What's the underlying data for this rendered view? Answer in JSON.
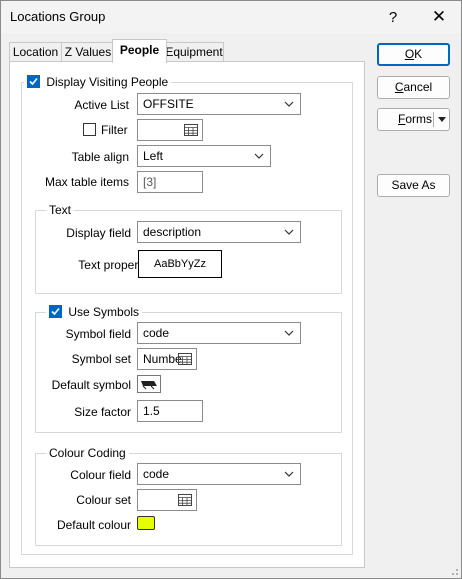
{
  "window": {
    "title": "Locations Group",
    "help_glyph": "?",
    "close_glyph": "✕"
  },
  "tabs": [
    {
      "label": "Location"
    },
    {
      "label": "Z Values"
    },
    {
      "label": "People",
      "active": true
    },
    {
      "label": "Equipment"
    }
  ],
  "display_visiting": {
    "label": "Display Visiting People",
    "checked": true
  },
  "active_list": {
    "label": "Active List",
    "value": "OFFSITE"
  },
  "filter": {
    "label": "Filter",
    "checked": false,
    "value": ""
  },
  "table_align": {
    "label": "Table align",
    "value": "Left"
  },
  "max_table_items": {
    "label": "Max table items",
    "value": "[3]"
  },
  "text_group": {
    "legend": "Text",
    "display_field_label": "Display field",
    "display_field_value": "description",
    "text_properties_label": "Text properties",
    "text_properties_sample": "AaBbYyZz"
  },
  "symbols_group": {
    "legend": "Use Symbols",
    "checked": true,
    "symbol_field_label": "Symbol field",
    "symbol_field_value": "code",
    "symbol_set_label": "Symbol set",
    "symbol_set_value": "Numbe",
    "default_symbol_label": "Default symbol",
    "size_factor_label": "Size factor",
    "size_factor_value": "1.5"
  },
  "colour_group": {
    "legend": "Colour Coding",
    "colour_field_label": "Colour field",
    "colour_field_value": "code",
    "colour_set_label": "Colour set",
    "colour_set_value": "",
    "default_colour_label": "Default colour",
    "default_colour": "#e6ff00"
  },
  "buttons": {
    "ok": {
      "prefix": "",
      "mnemonic": "O",
      "suffix": "K"
    },
    "cancel": {
      "prefix": "",
      "mnemonic": "C",
      "suffix": "ancel"
    },
    "forms": {
      "prefix": "",
      "mnemonic": "F",
      "suffix": "orms"
    },
    "save_as": "Save As"
  },
  "colors": {
    "accent": "#0067c0",
    "tab_border": "#c8c8c8",
    "group_border": "#d8d8d8"
  }
}
